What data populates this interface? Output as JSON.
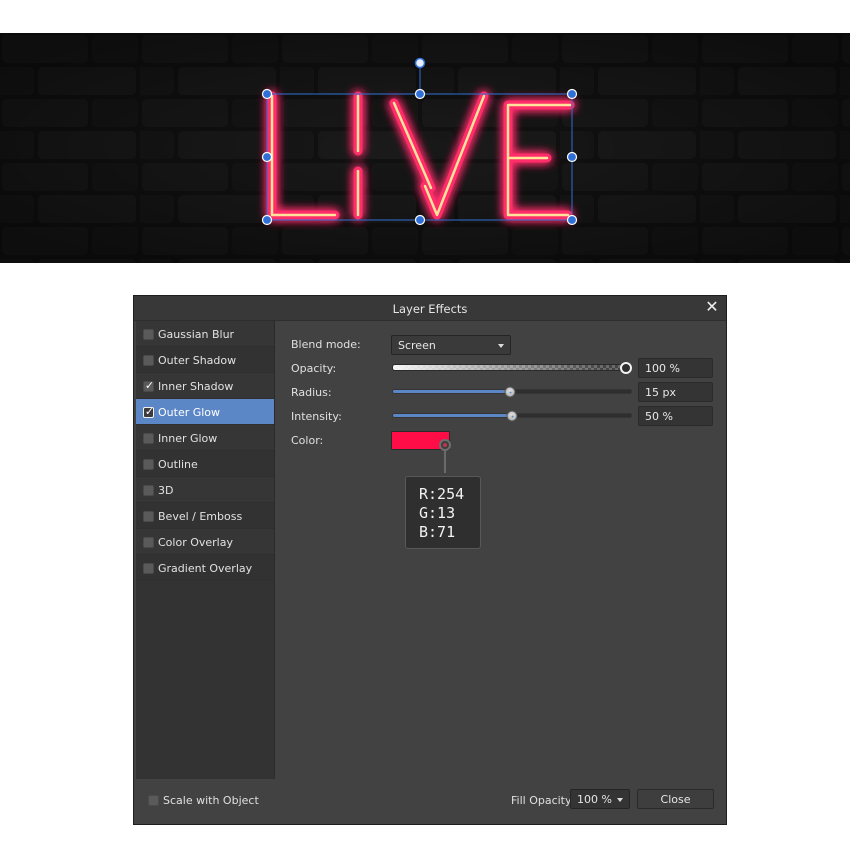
{
  "canvas": {
    "text": "LIVE",
    "neon_color": "#ff2d6a",
    "core_color": "#ffe39a",
    "selection_color": "#2f6fd6"
  },
  "dialog": {
    "title": "Layer Effects",
    "close_icon": "close-x",
    "effects": [
      {
        "label": "Gaussian Blur",
        "checked": false,
        "active": false
      },
      {
        "label": "Outer Shadow",
        "checked": false,
        "active": false
      },
      {
        "label": "Inner Shadow",
        "checked": true,
        "active": false
      },
      {
        "label": "Outer Glow",
        "checked": true,
        "active": true
      },
      {
        "label": "Inner Glow",
        "checked": false,
        "active": false
      },
      {
        "label": "Outline",
        "checked": false,
        "active": false
      },
      {
        "label": "3D",
        "checked": false,
        "active": false
      },
      {
        "label": "Bevel / Emboss",
        "checked": false,
        "active": false
      },
      {
        "label": "Color Overlay",
        "checked": false,
        "active": false
      },
      {
        "label": "Gradient Overlay",
        "checked": false,
        "active": false
      }
    ],
    "settings": {
      "blend_mode_label": "Blend mode:",
      "blend_mode_value": "Screen",
      "opacity_label": "Opacity:",
      "opacity_value": "100 %",
      "opacity_fraction": 1.0,
      "radius_label": "Radius:",
      "radius_value": "15 px",
      "radius_fraction": 0.49,
      "intensity_label": "Intensity:",
      "intensity_value": "50 %",
      "intensity_fraction": 0.5,
      "color_label": "Color:",
      "color_hex": "#fe0d47",
      "color_rgb": {
        "r": "R:254",
        "g": "G:13",
        "b": "B:71"
      }
    },
    "footer": {
      "scale_label": "Scale with Object",
      "scale_checked": false,
      "fill_opacity_label": "Fill Opacity:",
      "fill_opacity_value": "100 %",
      "close_label": "Close"
    }
  }
}
